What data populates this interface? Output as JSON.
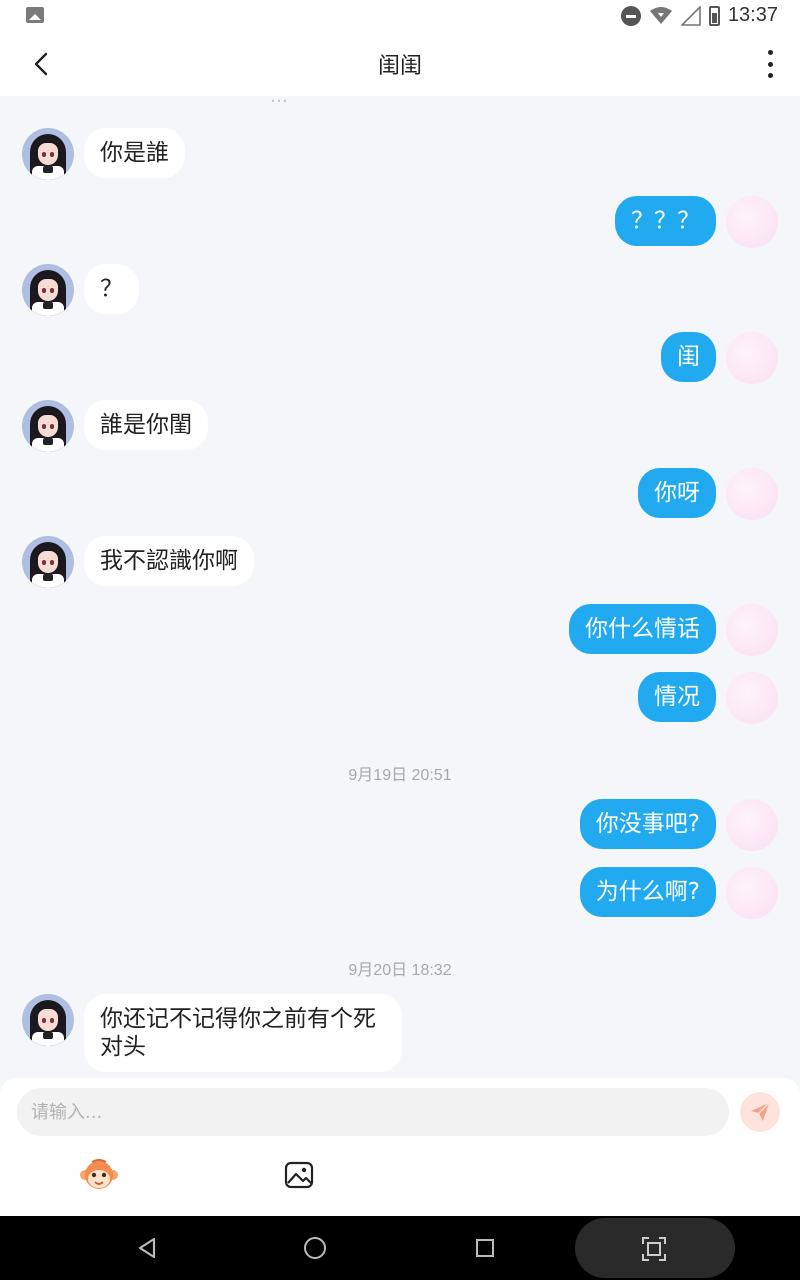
{
  "status_bar": {
    "time": "13:37",
    "icons": [
      "gallery-icon",
      "do-not-disturb-icon",
      "wifi-icon",
      "signal-icon",
      "battery-icon"
    ]
  },
  "header": {
    "title": "闺闺",
    "back_icon": "chevron-left-icon",
    "more_icon": "more-vertical-icon"
  },
  "chat": {
    "cut_off_text": "…",
    "messages": [
      {
        "side": "left",
        "text": "你是誰"
      },
      {
        "side": "right",
        "text": "？？？"
      },
      {
        "side": "left",
        "text": "？"
      },
      {
        "side": "right",
        "text": "闺"
      },
      {
        "side": "left",
        "text": "誰是你閨"
      },
      {
        "side": "right",
        "text": "你呀"
      },
      {
        "side": "left",
        "text": "我不認識你啊"
      },
      {
        "side": "right",
        "text": "你什么情话"
      },
      {
        "side": "right",
        "text": "情况"
      },
      {
        "side": "right",
        "text": "你没事吧?"
      },
      {
        "side": "right",
        "text": "为什么啊?"
      },
      {
        "side": "left",
        "text": "你还记不记得你之前有个死对头"
      }
    ],
    "timestamps": [
      "9月19日 20:51",
      "9月20日 18:32"
    ]
  },
  "composer": {
    "placeholder": "请输入...",
    "send_icon": "send-icon",
    "emoji_icon": "monkey-emoji-icon",
    "image_icon": "image-icon"
  },
  "colors": {
    "outgoing_bubble": "#22aaf0",
    "incoming_bubble": "#ffffff",
    "background": "#f4f6f9",
    "send_button": "#fde3dc",
    "send_icon": "#f8a08c"
  }
}
